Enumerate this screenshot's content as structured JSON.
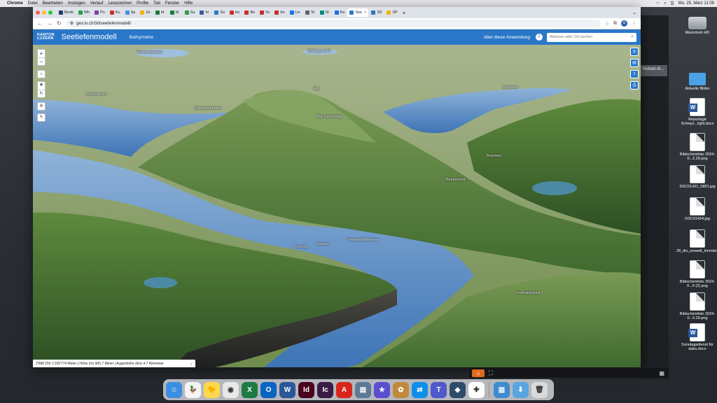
{
  "menubar": {
    "app": "Chrome",
    "menus": [
      "Datei",
      "Bearbeiten",
      "Anzeigen",
      "Verlauf",
      "Lesezeichen",
      "Profile",
      "Tab",
      "Fenster",
      "Hilfe"
    ],
    "datetime": "Mo. 25. März 11:09"
  },
  "browser": {
    "tabs": [
      {
        "label": "Beob",
        "color": "#1e3a6b"
      },
      {
        "label": "Wh",
        "color": "#25a244"
      },
      {
        "label": "Po",
        "color": "#7b3fa0"
      },
      {
        "label": "Ku",
        "color": "#c9302c"
      },
      {
        "label": "Sp",
        "color": "#4a90d9"
      },
      {
        "label": "Ze",
        "color": "#f0b400"
      },
      {
        "label": "Id",
        "color": "#1a7f37"
      },
      {
        "label": "Id",
        "color": "#1a7f37"
      },
      {
        "label": "Su",
        "color": "#2f9e44"
      },
      {
        "label": "hr",
        "color": "#3b5998"
      },
      {
        "label": "So",
        "color": "#2a77c9"
      },
      {
        "label": "bo",
        "color": "#c9302c"
      },
      {
        "label": "Bo",
        "color": "#c9302c"
      },
      {
        "label": "Sc",
        "color": "#c9302c"
      },
      {
        "label": "bo",
        "color": "#c9302c"
      },
      {
        "label": "Liv",
        "color": "#1a73e8"
      },
      {
        "label": "Te",
        "color": "#5f6368"
      },
      {
        "label": "St",
        "color": "#00897b"
      },
      {
        "label": "Ko",
        "color": "#1a73e8"
      },
      {
        "label": "See",
        "color": "#2a77c9",
        "active": true
      },
      {
        "label": "3D",
        "color": "#2a77c9"
      },
      {
        "label": "SP",
        "color": "#f0b400"
      }
    ],
    "url": "geo.lu.ch/3d/seetiefenmodell/"
  },
  "app": {
    "logo_line1": "KANTON",
    "logo_line2": "LUZERN",
    "title": "Seetiefenmodell",
    "tab": "Bathymetrie",
    "about_label": "über diese Anwendung",
    "search_placeholder": "Adresse oder Ort suchen"
  },
  "map": {
    "labels": [
      "Sempachersee",
      "Baldeggersee",
      "Luzernersee",
      "Küssnachtersee",
      "Zugersee",
      "Rigi",
      "Vierwaldstättersee",
      "Brunnen",
      "Frohnalpstock",
      "Rigi Scheidegg",
      "Gersau",
      "Buochs",
      "Beckenried"
    ],
    "status_text": "2'686'159 1'199'774 Meter | Höhe (m) 905.7 Meter | Augenhöhe (km) 4.7 Kilometer"
  },
  "sidewin": {
    "tooltip": "Holzen Al..."
  },
  "desktop": {
    "icons": [
      {
        "label": "Macintosh HD",
        "type": "hd"
      },
      {
        "label": "Aktuelle Bilder",
        "type": "folder"
      },
      {
        "label": "Reportage Schwyz...light.docx",
        "type": "word"
      },
      {
        "label": "Bildschirmfoto 2024-0...2.29.png",
        "type": "doc"
      },
      {
        "label": "DSC01421_0801.jpg",
        "type": "doc"
      },
      {
        "label": "DSC01424.jpg",
        "type": "doc"
      },
      {
        "label": "28_div_umwelt_lnnmändv...rosse.jpg",
        "type": "doc"
      },
      {
        "label": "Bildschirmfoto 2024-0...9 (2).png",
        "type": "doc"
      },
      {
        "label": "Bildschirmfoto 2024-0...0.29.png",
        "type": "doc"
      },
      {
        "label": "Sonntagsdienst für dabu.docx",
        "type": "word"
      }
    ]
  },
  "dock": {
    "apps": [
      {
        "name": "finder",
        "color": "#3b8fe0",
        "glyph": "☺"
      },
      {
        "name": "cyberduck",
        "color": "#f4f4f4",
        "glyph": "🦆"
      },
      {
        "name": "duck",
        "color": "#ffd84a",
        "glyph": "🐤"
      },
      {
        "name": "chrome",
        "color": "#e8e8e8",
        "glyph": "◉"
      },
      {
        "name": "excel",
        "color": "#1d7a43",
        "glyph": "X"
      },
      {
        "name": "outlook",
        "color": "#0a64c2",
        "glyph": "O"
      },
      {
        "name": "word",
        "color": "#2b579a",
        "glyph": "W"
      },
      {
        "name": "indesign",
        "color": "#49021f",
        "glyph": "Id"
      },
      {
        "name": "incopy",
        "color": "#3a1b46",
        "glyph": "Ic"
      },
      {
        "name": "acrobat",
        "color": "#d9261c",
        "glyph": "A"
      },
      {
        "name": "preview",
        "color": "#5d7a95",
        "glyph": "▤"
      },
      {
        "name": "imovie",
        "color": "#5a4fcf",
        "glyph": "★"
      },
      {
        "name": "squirrel",
        "color": "#c08a3e",
        "glyph": "✿"
      },
      {
        "name": "teamviewer",
        "color": "#0e8ee9",
        "glyph": "⇄"
      },
      {
        "name": "teams",
        "color": "#5059c9",
        "glyph": "T"
      },
      {
        "name": "davinci",
        "color": "#2f4d6a",
        "glyph": "◆"
      },
      {
        "name": "slack",
        "color": "#ffffff",
        "glyph": "✚"
      },
      {
        "name": "applications-folder",
        "color": "#3e8ccf",
        "glyph": "▥"
      },
      {
        "name": "downloads-folder",
        "color": "#58a6e0",
        "glyph": "⬇"
      },
      {
        "name": "trash",
        "color": "#d8dadd",
        "glyph": "🗑"
      }
    ]
  }
}
